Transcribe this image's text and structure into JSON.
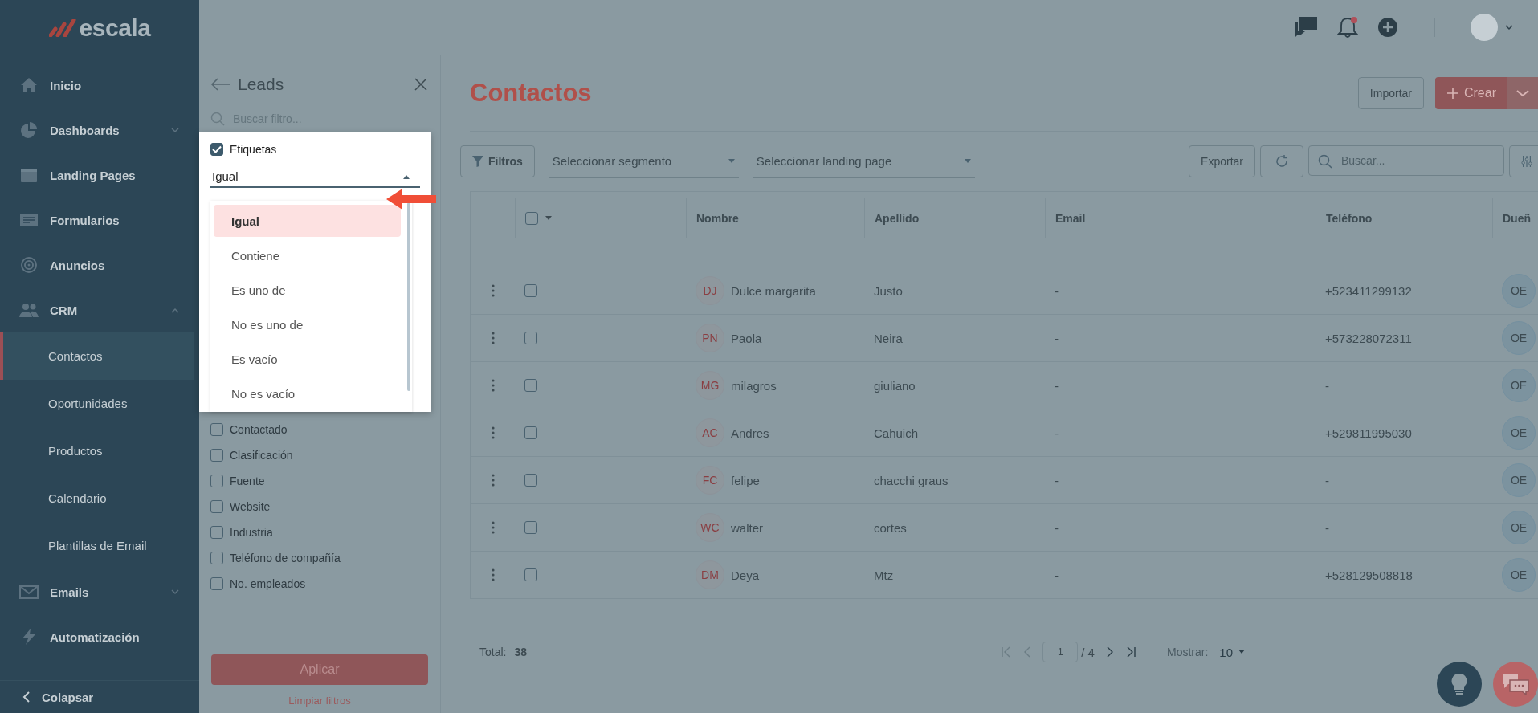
{
  "sidebar": {
    "logo": "escala",
    "items": [
      {
        "label": "Inicio",
        "selected": false
      },
      {
        "label": "Dashboards",
        "selected": false,
        "expanded": false
      },
      {
        "label": "Landing Pages",
        "selected": false
      },
      {
        "label": "Formularios",
        "selected": false
      },
      {
        "label": "Anuncios",
        "selected": false
      },
      {
        "label": "CRM",
        "selected": false,
        "expanded": true,
        "children": [
          {
            "label": "Contactos",
            "selected": true
          },
          {
            "label": "Oportunidades",
            "selected": false
          },
          {
            "label": "Productos",
            "selected": false
          },
          {
            "label": "Calendario",
            "selected": false
          },
          {
            "label": "Plantillas de Email",
            "selected": false
          }
        ]
      },
      {
        "label": "Emails",
        "selected": false,
        "expanded": false
      },
      {
        "label": "Automatización",
        "selected": false
      }
    ],
    "collapse": "Colapsar"
  },
  "topbar": {
    "notifications": true
  },
  "filter_panel": {
    "title": "Leads",
    "search": {
      "placeholder": "Buscar filtro..."
    },
    "active_filter": {
      "label": "Etiquetas",
      "checked": true,
      "operator": "Igual",
      "expanded": true,
      "options": [
        {
          "label": "Igual",
          "selected": true
        },
        {
          "label": "Contiene",
          "selected": false
        },
        {
          "label": "Es uno de",
          "selected": false
        },
        {
          "label": "No es uno de",
          "selected": false
        },
        {
          "label": "Es vacío",
          "selected": false
        },
        {
          "label": "No es vacío",
          "selected": false
        }
      ]
    },
    "filters": [
      {
        "label": "Contactado",
        "checked": false
      },
      {
        "label": "Clasificación",
        "checked": false
      },
      {
        "label": "Fuente",
        "checked": false
      },
      {
        "label": "Website",
        "checked": false
      },
      {
        "label": "Industria",
        "checked": false
      },
      {
        "label": "Teléfono de compañía",
        "checked": false
      },
      {
        "label": "No. empleados",
        "checked": false
      }
    ],
    "apply": "Aplicar",
    "clear": "Limpiar filtros"
  },
  "main": {
    "title": "Contactos",
    "import": "Importar",
    "create": "Crear",
    "toolbar": {
      "filters": "Filtros",
      "segment": "Seleccionar segmento",
      "landing": "Seleccionar landing page",
      "export": "Exportar",
      "search": {
        "placeholder": "Buscar..."
      }
    },
    "table": {
      "columns": [
        "Nombre",
        "Apellido",
        "Email",
        "Teléfono",
        "Dueñ"
      ],
      "select_all": false,
      "rows": [
        {
          "initials": "DJ",
          "name": "Dulce margarita",
          "last": "Justo",
          "email": "-",
          "phone": "+523411299132",
          "owner": "OE",
          "checked": false
        },
        {
          "initials": "PN",
          "name": "Paola",
          "last": "Neira",
          "email": "-",
          "phone": "+573228072311",
          "owner": "OE",
          "checked": false
        },
        {
          "initials": "MG",
          "name": "milagros",
          "last": "giuliano",
          "email": "-",
          "phone": "-",
          "owner": "OE",
          "checked": false
        },
        {
          "initials": "AC",
          "name": "Andres",
          "last": "Cahuich",
          "email": "-",
          "phone": "+529811995030",
          "owner": "OE",
          "checked": false
        },
        {
          "initials": "FC",
          "name": "felipe",
          "last": "chacchi graus",
          "email": "-",
          "phone": "-",
          "owner": "OE",
          "checked": false
        },
        {
          "initials": "WC",
          "name": "walter",
          "last": "cortes",
          "email": "-",
          "phone": "-",
          "owner": "OE",
          "checked": false
        },
        {
          "initials": "DM",
          "name": "Deya",
          "last": "Mtz",
          "email": "-",
          "phone": "+528129508818",
          "owner": "OE",
          "checked": false
        }
      ]
    },
    "footer": {
      "total_label": "Total:",
      "total": "38",
      "page": "1",
      "pages": "/ 4",
      "show_label": "Mostrar:",
      "per_page": "10"
    }
  }
}
